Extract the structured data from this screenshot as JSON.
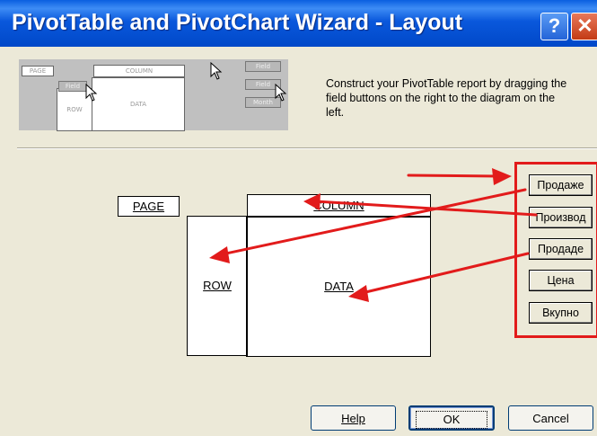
{
  "window": {
    "title": "PivotTable and PivotChart Wizard - Layout",
    "help_glyph": "?",
    "close_glyph": "✕"
  },
  "preview": {
    "page": "PAGE",
    "column": "COLUMN",
    "row": "ROW",
    "data": "DATA",
    "field": "Field",
    "btn1": "Field",
    "btn2": "Field",
    "btn3": "Month"
  },
  "instructions": "Construct your PivotTable report by dragging the field buttons on the right to the diagram on the left.",
  "layout": {
    "page": "PAGE",
    "column": "COLUMN",
    "row": "ROW",
    "data": "DATA"
  },
  "fields": [
    "Продаже",
    "Производ",
    "Продаде",
    "Цена",
    "Вкупно"
  ],
  "buttons": {
    "help": "Help",
    "ok": "OK",
    "cancel": "Cancel"
  },
  "annotation_color": "#e21b1b"
}
